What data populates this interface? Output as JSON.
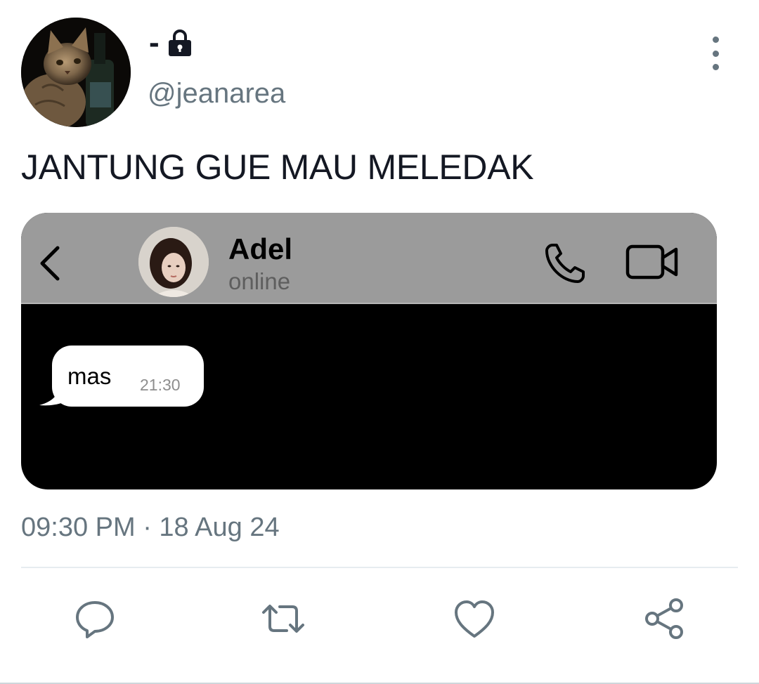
{
  "tweet": {
    "display_name": "-",
    "handle": "@jeanarea",
    "text": "JANTUNG GUE MAU MELEDAK",
    "timestamp": "09:30 PM · 18 Aug 24",
    "avatar_icon": "cat-photo-avatar",
    "protected_icon": "lock-icon",
    "more_icon": "vertical-dots-icon"
  },
  "media": {
    "contact_name": "Adel",
    "contact_status": "online",
    "message_text": "mas",
    "message_time": "21:30",
    "icons": [
      "back-chevron-icon",
      "phone-icon",
      "video-camera-icon"
    ]
  },
  "actions": [
    {
      "name": "reply",
      "icon": "reply-bubble-icon"
    },
    {
      "name": "retweet",
      "icon": "retweet-icon"
    },
    {
      "name": "like",
      "icon": "heart-icon"
    },
    {
      "name": "share",
      "icon": "share-icon"
    }
  ],
  "colors": {
    "secondary_text": "#66757f",
    "chat_header_bg": "#9b9b9b",
    "chat_body_bg": "#000000",
    "bubble_bg": "#ffffff"
  }
}
